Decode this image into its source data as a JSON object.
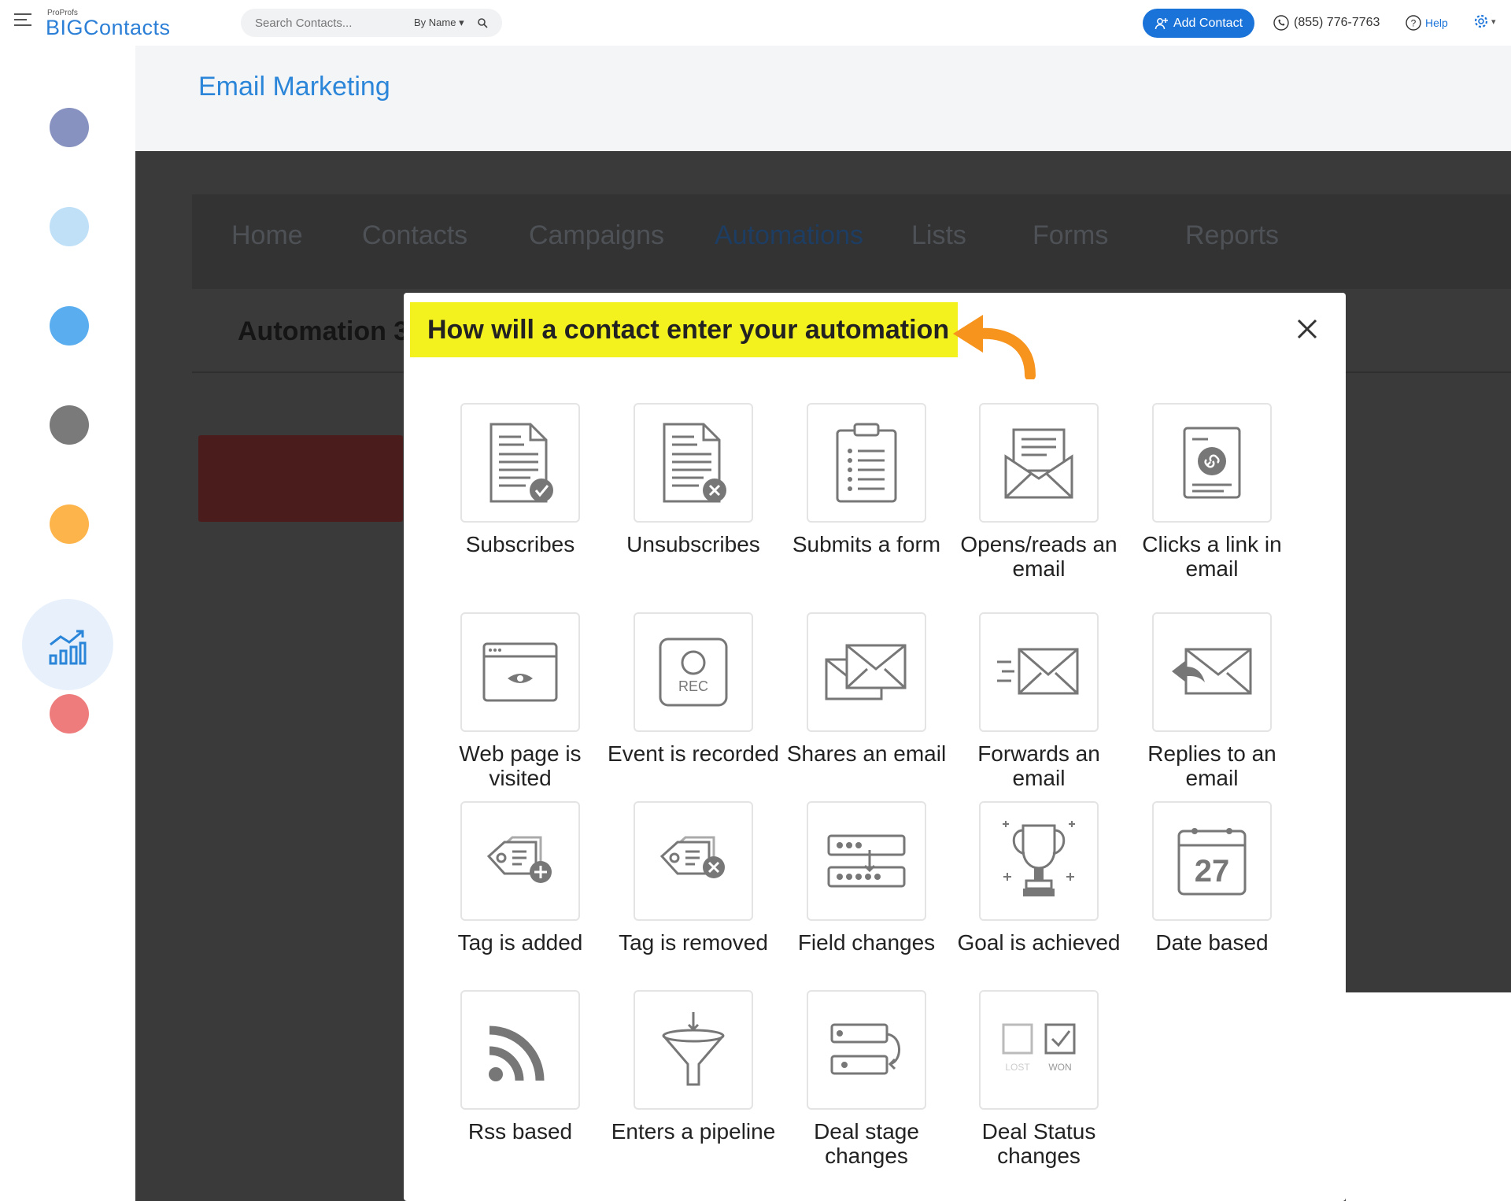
{
  "brand": {
    "small": "ProProfs",
    "name": "BIGContacts"
  },
  "search": {
    "placeholder": "Search Contacts...",
    "by_label": "By Name"
  },
  "header": {
    "add_contact_label": "Add Contact",
    "phone": "(855) 776-7763",
    "help_label": "Help"
  },
  "rail": {
    "colors": [
      "#8792c0",
      "#bfe0f7",
      "#5aaef0",
      "#7a7a7a",
      "#fdb44b",
      "#ee7c7c"
    ],
    "active_icon": "analytics-icon"
  },
  "page": {
    "title": "Email Marketing"
  },
  "nav": [
    "Home",
    "Contacts",
    "Campaigns",
    "Automations",
    "Lists",
    "Forms",
    "Reports"
  ],
  "nav_active": "Automations",
  "automation": {
    "title": "Automation 3"
  },
  "modal": {
    "heading": "How will a contact enter your automation",
    "triggers": [
      {
        "label": "Subscribes",
        "icon": "subscribe-doc-icon"
      },
      {
        "label": "Unsubscribes",
        "icon": "unsubscribe-doc-icon"
      },
      {
        "label": "Submits a form",
        "icon": "clipboard-form-icon"
      },
      {
        "label": "Opens/reads an email",
        "icon": "open-envelope-icon"
      },
      {
        "label": "Clicks a link in email",
        "icon": "link-doc-icon"
      },
      {
        "label": "Web page is visited",
        "icon": "browser-eye-icon"
      },
      {
        "label": "Event is recorded",
        "icon": "rec-camera-icon"
      },
      {
        "label": "Shares an email",
        "icon": "share-envelopes-icon"
      },
      {
        "label": "Forwards an email",
        "icon": "forward-envelope-icon"
      },
      {
        "label": "Replies to an email",
        "icon": "reply-envelope-icon"
      },
      {
        "label": "Tag is added",
        "icon": "tag-add-icon"
      },
      {
        "label": "Tag is removed",
        "icon": "tag-remove-icon"
      },
      {
        "label": "Field changes",
        "icon": "field-change-icon"
      },
      {
        "label": "Goal is achieved",
        "icon": "trophy-icon"
      },
      {
        "label": "Date based",
        "icon": "calendar-icon"
      },
      {
        "label": "Rss based",
        "icon": "rss-icon"
      },
      {
        "label": "Enters a pipeline",
        "icon": "funnel-icon"
      },
      {
        "label": "Deal stage changes",
        "icon": "deal-stage-icon"
      },
      {
        "label": "Deal Status changes",
        "icon": "deal-status-icon"
      }
    ],
    "calendar_day": "27",
    "rec_label": "REC",
    "lost_label": "LOST",
    "won_label": "WON"
  }
}
